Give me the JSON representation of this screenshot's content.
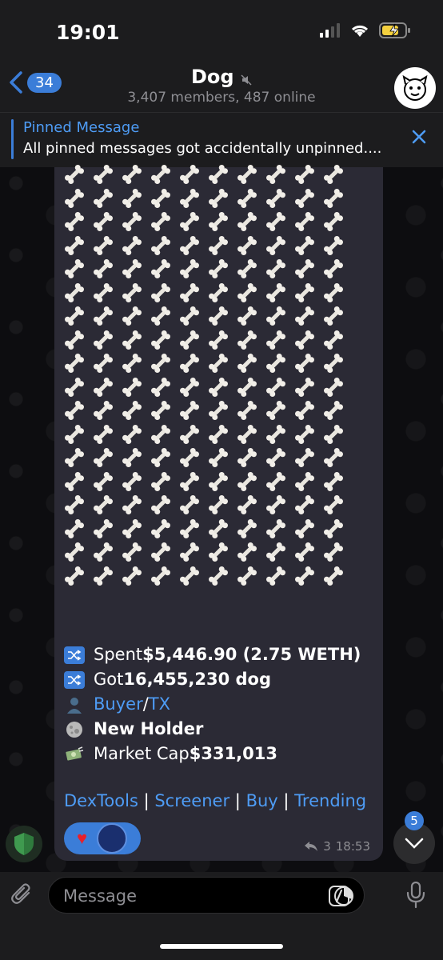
{
  "status_bar": {
    "time": "19:01"
  },
  "header": {
    "back_count": "34",
    "title": "Dog",
    "subtitle": "3,407 members, 487 online"
  },
  "pinned": {
    "title": "Pinned Message",
    "text": "All pinned messages got accidentally unpinned...."
  },
  "message": {
    "bones": {
      "rows": 18,
      "cols": 10
    },
    "lines": [
      {
        "emoji": "shuffle-icon",
        "prefix": "Spent ",
        "bold": "$5,446.90 (2.75 WETH)"
      },
      {
        "emoji": "shuffle-icon",
        "prefix": "Got ",
        "bold": "16,455,230 dog"
      },
      {
        "emoji": "user-icon",
        "link1": "Buyer",
        "sep": " / ",
        "link2": "TX"
      },
      {
        "emoji": "moon-icon",
        "bold": "New Holder"
      },
      {
        "emoji": "money-icon",
        "prefix": "Market Cap ",
        "bold": "$331,013"
      }
    ],
    "links": [
      "DexTools",
      "Screener",
      "Buy",
      "Trending"
    ],
    "reply_count": "3",
    "time": "18:53"
  },
  "scroll": {
    "unread": "5"
  },
  "composer": {
    "placeholder": "Message"
  },
  "colors": {
    "accent": "#3b7dd8",
    "link": "#4e9cf5",
    "bubble": "#2b2a35",
    "header": "#1c1c1e"
  }
}
